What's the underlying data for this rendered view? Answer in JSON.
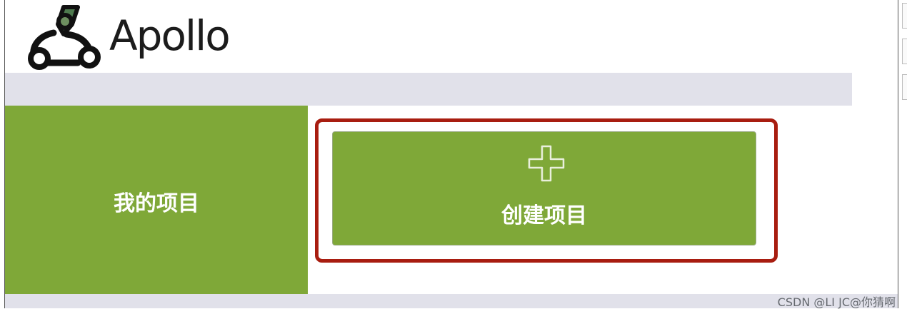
{
  "header": {
    "brand": "Apollo"
  },
  "sidebar": {
    "my_projects_label": "我的项目"
  },
  "main": {
    "create_project_label": "创建项目"
  },
  "watermark": "CSDN @LI JC@你猜啊",
  "colors": {
    "accent_green": "#7fa838",
    "highlight_red": "#a81d10",
    "nav_gray": "#e1e1ea"
  },
  "icons": {
    "logo": "apollo-logo-icon",
    "plus": "plus-icon"
  }
}
